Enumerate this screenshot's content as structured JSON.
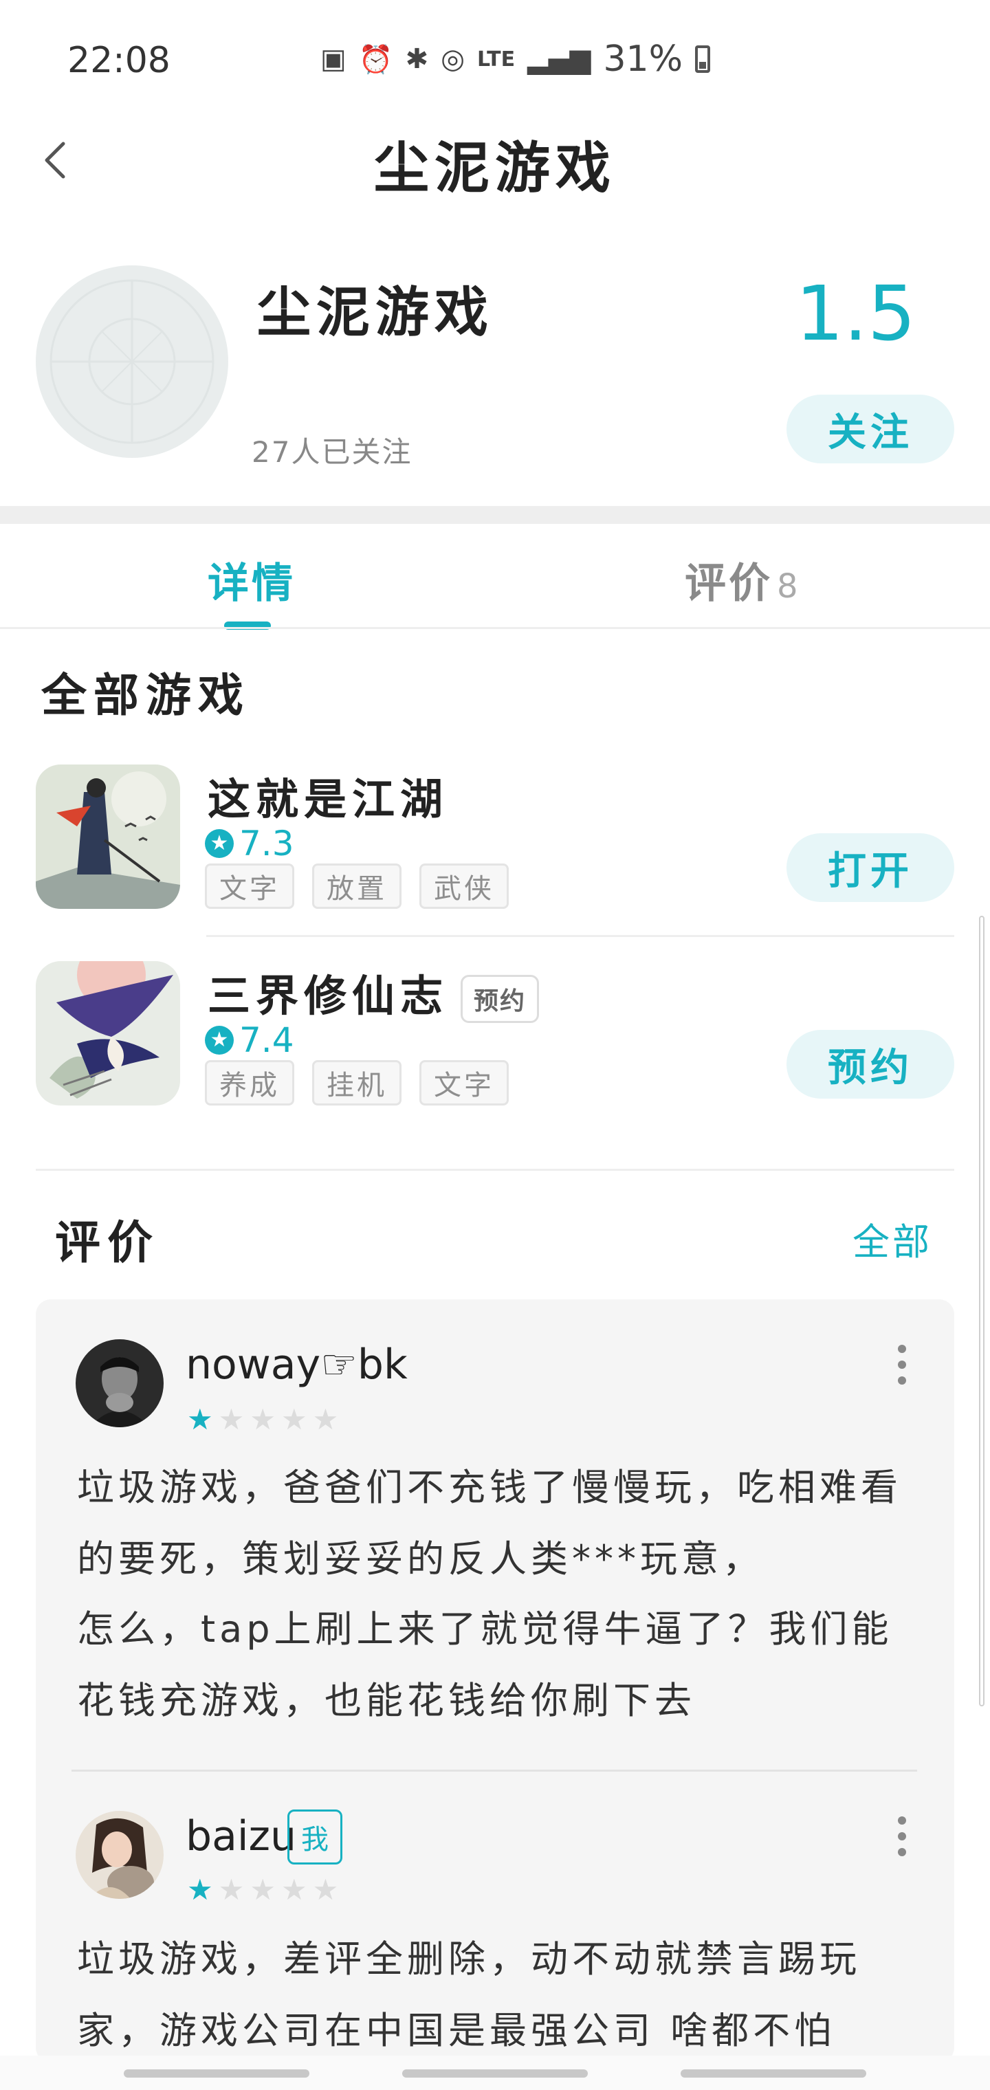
{
  "status_bar": {
    "time": "22:08",
    "network": "LTE",
    "battery": "31%"
  },
  "header": {
    "title": "尘泥游戏"
  },
  "publisher": {
    "name": "尘泥游戏",
    "followers": "27人已关注",
    "score": "1.5",
    "follow_label": "关注"
  },
  "tabs": {
    "detail": "详情",
    "reviews": "评价",
    "reviews_count": "8"
  },
  "games_section": {
    "title": "全部游戏",
    "games": [
      {
        "title": "这就是江湖",
        "badge": "",
        "rating": "7.3",
        "tags": [
          "文字",
          "放置",
          "武侠"
        ],
        "action": "打开"
      },
      {
        "title": "三界修仙志",
        "badge": "预约",
        "rating": "7.4",
        "tags": [
          "养成",
          "挂机",
          "文字"
        ],
        "action": "预约"
      }
    ]
  },
  "reviews_section": {
    "title": "评价",
    "all_label": "全部",
    "reviews": [
      {
        "user": "noway☞bk",
        "me_badge": "",
        "stars": 1,
        "paragraphs": [
          "垃圾游戏，爸爸们不充钱了慢慢玩，吃相难看的要死，策划妥妥的反人类***玩意，",
          "怎么，tap上刷上来了就觉得牛逼了？我们能花钱充游戏，也能花钱给你刷下去"
        ]
      },
      {
        "user": "baizu",
        "me_badge": "我",
        "stars": 1,
        "paragraphs": [
          "垃圾游戏，差评全删除，动不动就禁言踢玩家，游戏公司在中国是最强公司 啥都不怕"
        ]
      }
    ]
  },
  "colors": {
    "accent": "#17b1c2",
    "accent_bg": "#e7f6f8"
  }
}
